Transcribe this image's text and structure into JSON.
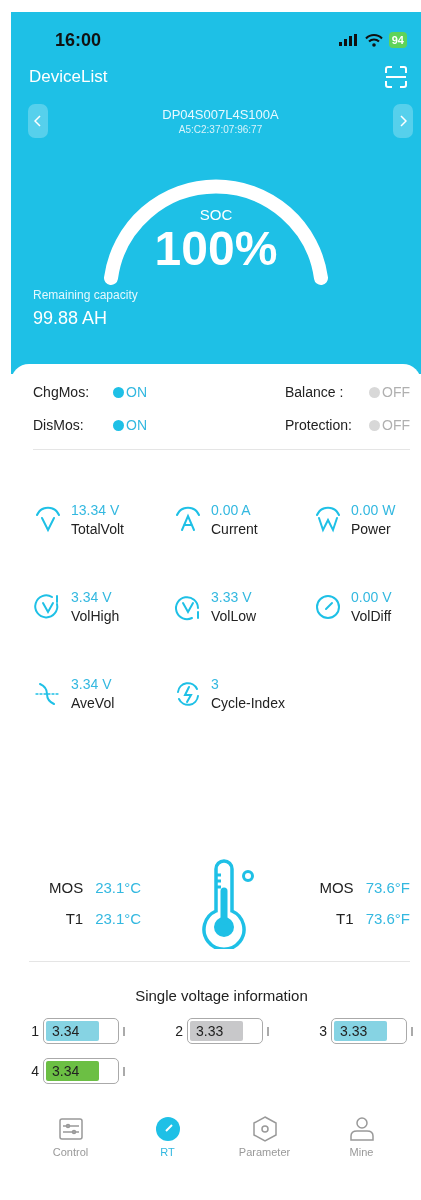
{
  "status_bar": {
    "time": "16:00",
    "battery": "94"
  },
  "header": {
    "title": "DeviceList"
  },
  "device": {
    "name": "DP04S007L4S100A",
    "mac": "A5:C2:37:07:96:77"
  },
  "soc": {
    "label": "SOC",
    "value": "100%"
  },
  "remaining": {
    "label": "Remaining capacity",
    "value": "99.88 AH"
  },
  "switches": [
    {
      "label": "ChgMos:",
      "value": "ON",
      "on": true
    },
    {
      "label": "Balance :",
      "value": "OFF",
      "on": false
    },
    {
      "label": "DisMos:",
      "value": "ON",
      "on": true
    },
    {
      "label": "Protection:",
      "value": "OFF",
      "on": false
    }
  ],
  "metrics": [
    {
      "kind": "volt",
      "value": "13.34 V",
      "label": "TotalVolt"
    },
    {
      "kind": "amp",
      "value": "0.00 A",
      "label": "Current"
    },
    {
      "kind": "watt",
      "value": "0.00 W",
      "label": "Power"
    },
    {
      "kind": "high",
      "value": "3.34 V",
      "label": "VolHigh"
    },
    {
      "kind": "low",
      "value": "3.33 V",
      "label": "VolLow"
    },
    {
      "kind": "diff",
      "value": "0.00 V",
      "label": "VolDiff"
    },
    {
      "kind": "avg",
      "value": "3.34 V",
      "label": "AveVol"
    },
    {
      "kind": "cycle",
      "value": "3",
      "label": "Cycle-Index"
    }
  ],
  "temperatures": {
    "celsius": [
      {
        "label": "MOS",
        "value": "23.1°C"
      },
      {
        "label": "T1",
        "value": "23.1°C"
      }
    ],
    "fahrenheit": [
      {
        "label": "MOS",
        "value": "73.6°F"
      },
      {
        "label": "T1",
        "value": "73.6°F"
      }
    ]
  },
  "cells_title": "Single voltage information",
  "cells": [
    {
      "index": "1",
      "value": "3.34",
      "color": "#86d3e3",
      "level": 0.75
    },
    {
      "index": "2",
      "value": "3.33",
      "color": "#c8c8ca",
      "level": 0.75
    },
    {
      "index": "3",
      "value": "3.33",
      "color": "#86d3e3",
      "level": 0.75
    },
    {
      "index": "4",
      "value": "3.34",
      "color": "#6cbf44",
      "level": 0.75
    }
  ],
  "tabs": [
    {
      "kind": "control",
      "label": "Control",
      "selected": false
    },
    {
      "kind": "rt",
      "label": "RT",
      "selected": true
    },
    {
      "kind": "parameter",
      "label": "Parameter",
      "selected": false
    },
    {
      "kind": "mine",
      "label": "Mine",
      "selected": false
    }
  ]
}
